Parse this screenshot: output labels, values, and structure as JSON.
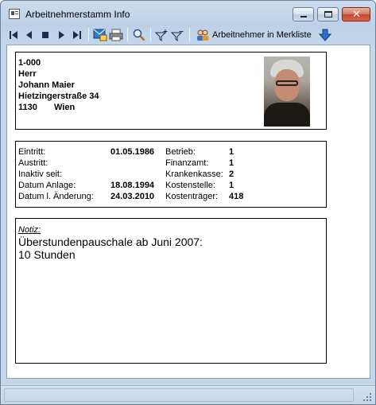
{
  "window": {
    "title": "Arbeitnehmerstamm Info",
    "controls": {
      "minimize": "minimize",
      "maximize": "maximize",
      "close": "✕"
    }
  },
  "toolbar": {
    "buttons": [
      {
        "name": "first-record",
        "icon": "skip-first-icon"
      },
      {
        "name": "previous-record",
        "icon": "prev-icon"
      },
      {
        "name": "stop",
        "icon": "stop-icon"
      },
      {
        "name": "next-record",
        "icon": "next-icon"
      },
      {
        "name": "last-record",
        "icon": "skip-last-icon"
      },
      {
        "name": "email",
        "icon": "email-icon"
      },
      {
        "name": "print",
        "icon": "printer-icon"
      },
      {
        "name": "search",
        "icon": "magnifier-icon"
      },
      {
        "name": "filter-add",
        "icon": "filter-plus-icon"
      },
      {
        "name": "filter-remove",
        "icon": "filter-minus-icon"
      },
      {
        "name": "merkliste",
        "icon": "people-icon"
      },
      {
        "name": "download",
        "icon": "arrow-down-icon"
      }
    ],
    "merkliste_label": "Arbeitnehmer in Merkliste"
  },
  "employee": {
    "number": "1-000",
    "salutation": "Herr",
    "name": "Johann Maier",
    "street": "Hietzingerstraße 34",
    "zip": "1130",
    "city": "Wien"
  },
  "details": {
    "left": [
      {
        "label": "Eintritt:",
        "value": "01.05.1986"
      },
      {
        "label": "Austritt:",
        "value": ""
      },
      {
        "label": "Inaktiv seit:",
        "value": ""
      },
      {
        "label": "Datum Anlage:",
        "value": "18.08.1994"
      },
      {
        "label": "Datum l. Änderung:",
        "value": "24.03.2010"
      }
    ],
    "right": [
      {
        "label": "Betrieb:",
        "value": "1"
      },
      {
        "label": "Finanzamt:",
        "value": "1"
      },
      {
        "label": "Krankenkasse:",
        "value": "2"
      },
      {
        "label": "Kostenstelle:",
        "value": "1"
      },
      {
        "label": "Kostenträger:",
        "value": "418"
      }
    ]
  },
  "notes": {
    "label": "Notiz:",
    "text": "Überstundenpauschale ab Juni 2007:\n10 Stunden"
  },
  "colors": {
    "chrome": "#c4d6ea",
    "border": "#000000",
    "accent_blue": "#2d6fd0"
  }
}
